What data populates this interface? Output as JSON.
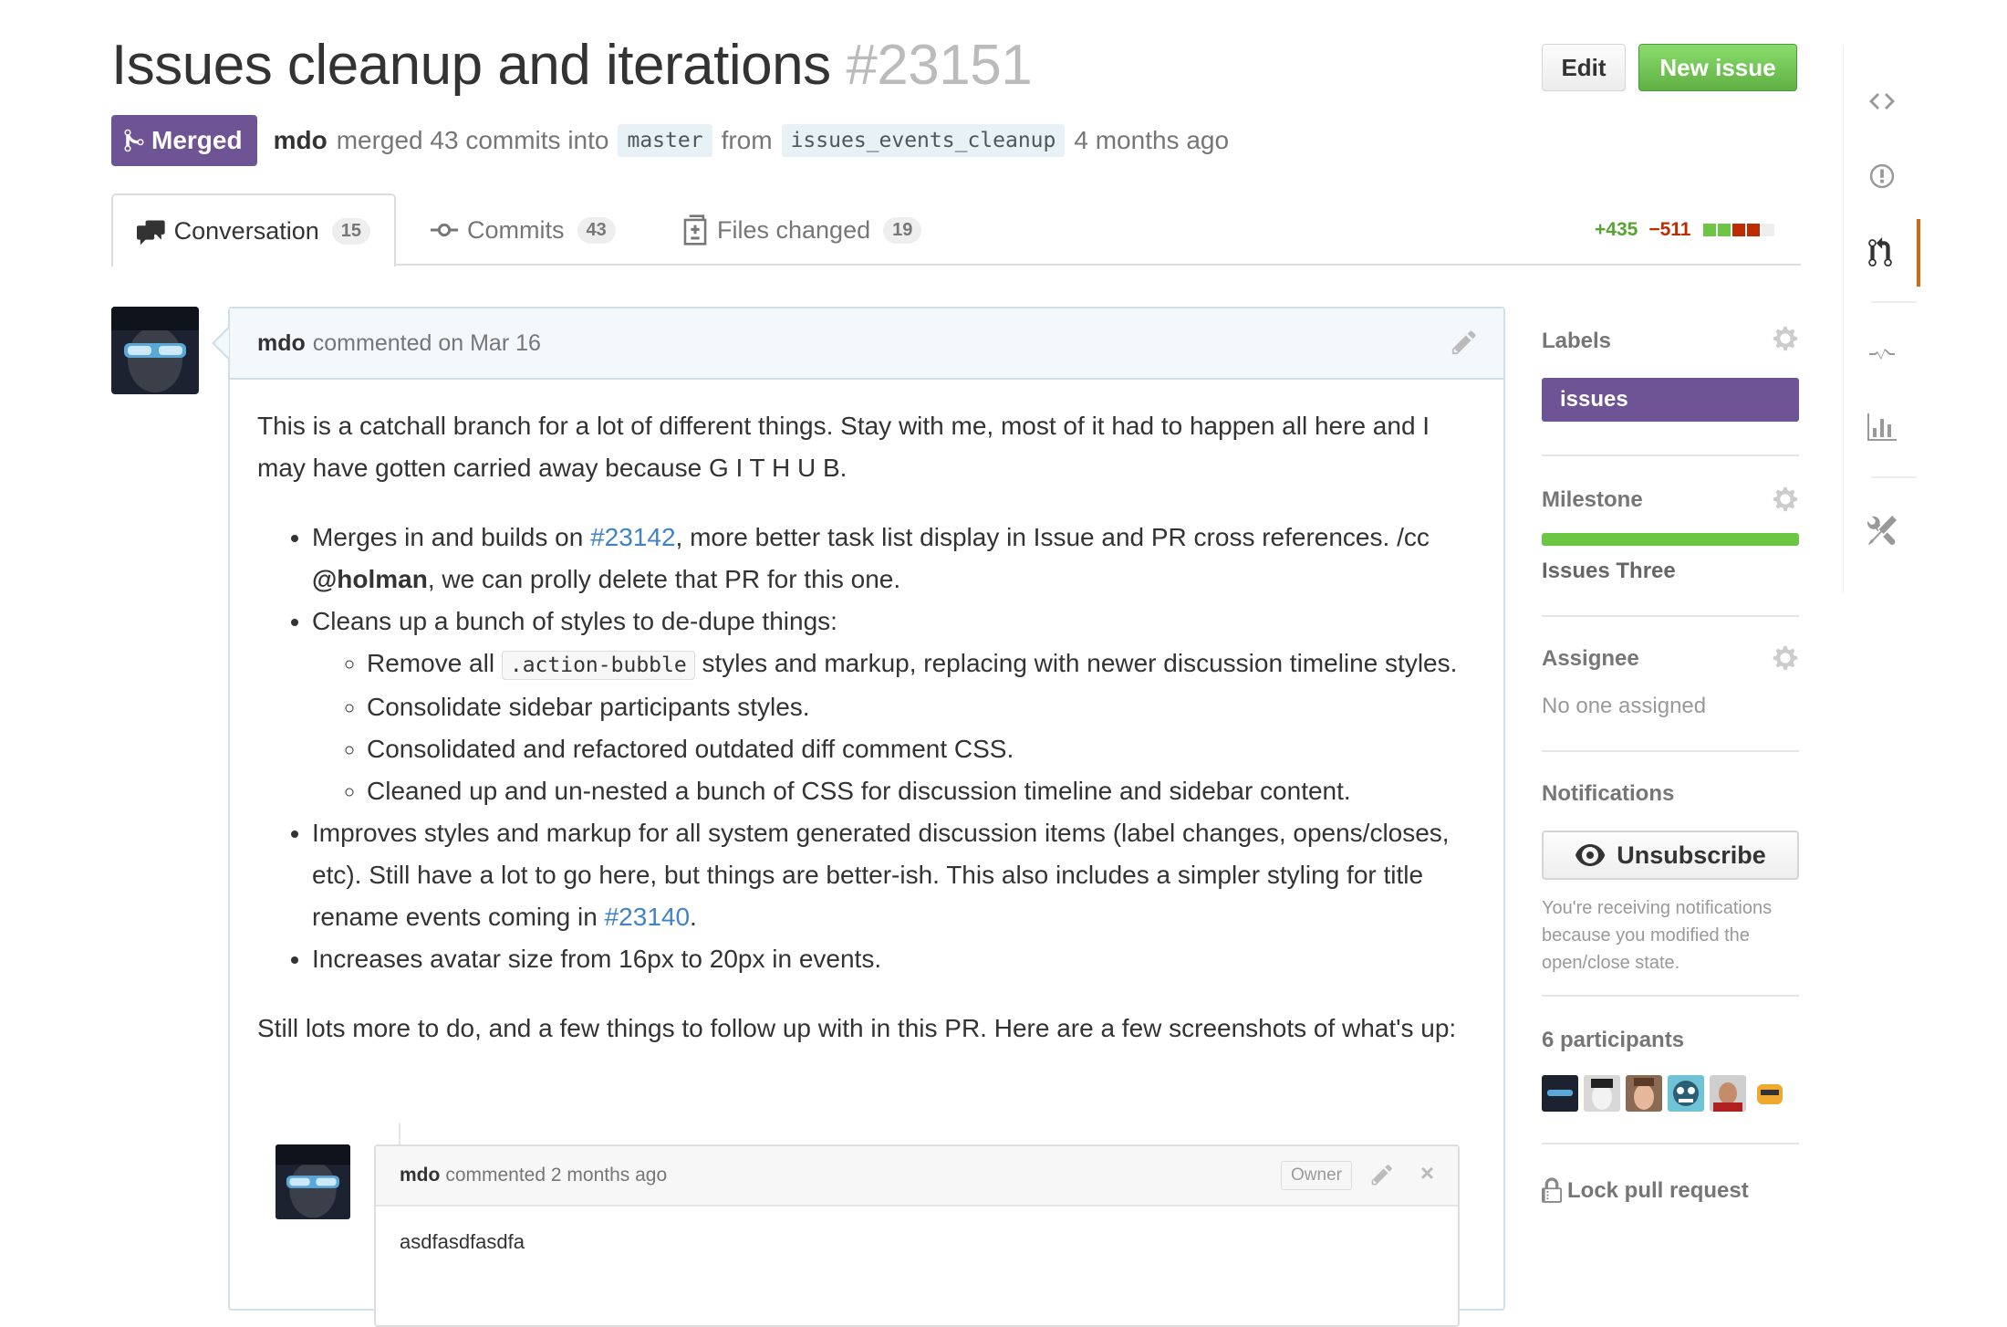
{
  "header": {
    "title": "Issues cleanup and iterations",
    "number": "#23151",
    "edit_label": "Edit",
    "new_issue_label": "New issue"
  },
  "status": {
    "state": "Merged",
    "author": "mdo",
    "merged_text": "merged 43 commits into",
    "base_branch": "master",
    "from_text": "from",
    "head_branch": "issues_events_cleanup",
    "time": "4 months ago"
  },
  "tabs": [
    {
      "label": "Conversation",
      "count": "15",
      "icon": "comment-discussion-icon"
    },
    {
      "label": "Commits",
      "count": "43",
      "icon": "commit-icon"
    },
    {
      "label": "Files changed",
      "count": "19",
      "icon": "diff-icon"
    }
  ],
  "diffstat": {
    "additions": "+435",
    "deletions": "−511"
  },
  "comment": {
    "author": "mdo",
    "meta": "commented on Mar 16",
    "intro": "This is a catchall branch for a lot of different things. Stay with me, most of it had to happen all here and I may have gotten carried away because G I T H U B.",
    "b1_pre": "Merges in and builds on ",
    "b1_link": "#23142",
    "b1_mid": ", more better task list display in Issue and PR cross references. /cc ",
    "b1_mention": "@holman",
    "b1_post": ", we can prolly delete that PR for this one.",
    "b2": "Cleans up a bunch of styles to de-dupe things:",
    "b2_s1_pre": "Remove all ",
    "b2_s1_code": ".action-bubble",
    "b2_s1_post": " styles and markup, replacing with newer discussion timeline styles.",
    "b2_s2": "Consolidate sidebar participants styles.",
    "b2_s3": "Consolidated and refactored outdated diff comment CSS.",
    "b2_s4": "Cleaned up and un-nested a bunch of CSS for discussion timeline and sidebar content.",
    "b3_pre": "Improves styles and markup for all system generated discussion items (label changes, opens/closes, etc). Still have a lot to go here, but things are better-ish. This also includes a simpler styling for title rename events coming in ",
    "b3_link": "#23140",
    "b3_post": ".",
    "b4": "Increases avatar size from 16px to 20px in events.",
    "outro": "Still lots more to do, and a few things to follow up with in this PR. Here are a few screenshots of what's up:"
  },
  "embed": {
    "author": "mdo",
    "meta": "commented 2 months ago",
    "badge": "Owner",
    "close": "×",
    "body": "asdfasdfasdfa"
  },
  "sidebar": {
    "labels_title": "Labels",
    "label": "issues",
    "milestone_title": "Milestone",
    "milestone_name": "Issues Three",
    "milestone_progress": 1.0,
    "assignee_title": "Assignee",
    "assignee_value": "No one assigned",
    "notifications_title": "Notifications",
    "unsubscribe_label": "Unsubscribe",
    "notifications_reason": "You're receiving notifications because you modified the open/close state.",
    "participants_title": "6 participants",
    "lock_label": "Lock pull request"
  },
  "colors": {
    "merged": "#6e5494",
    "new_issue": "#6cc644",
    "link": "#4183c4",
    "addition": "#55a532",
    "deletion": "#bd2c00",
    "repo_nav_active": "#d26911"
  }
}
